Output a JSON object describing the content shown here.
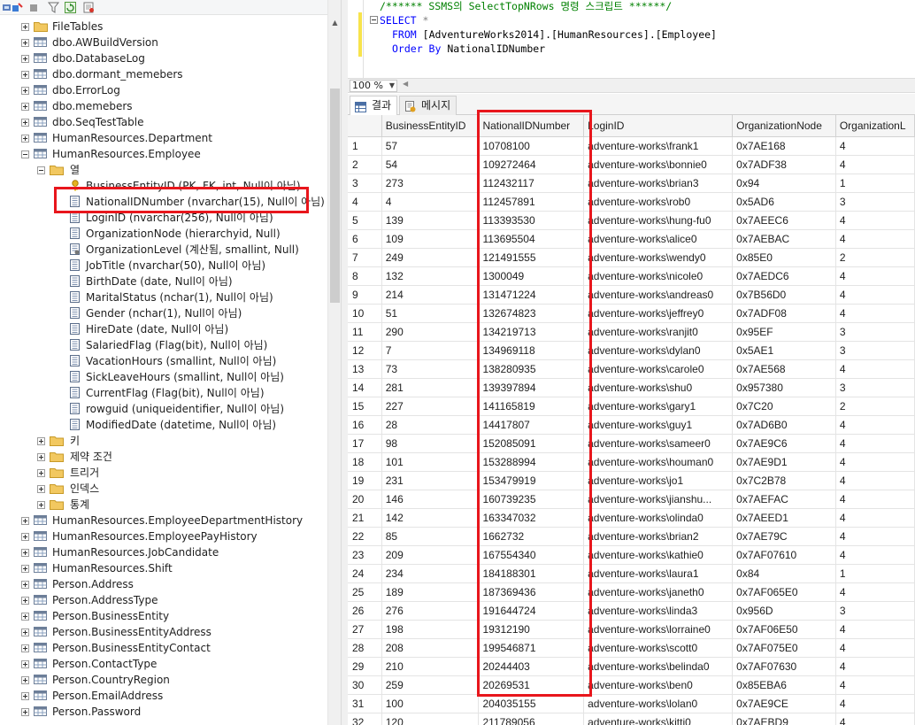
{
  "object_explorer": {
    "toolbar_icons": [
      "connect-icon",
      "connect-object-icon",
      "disconnect-icon",
      "stop-icon",
      "filter-icon",
      "refresh-icon",
      "activity-monitor-icon"
    ],
    "tree": [
      {
        "label": "FileTables",
        "level": 1,
        "icon": "folder",
        "expander": "plus"
      },
      {
        "label": "dbo.AWBuildVersion",
        "level": 1,
        "icon": "table",
        "expander": "plus"
      },
      {
        "label": "dbo.DatabaseLog",
        "level": 1,
        "icon": "table",
        "expander": "plus"
      },
      {
        "label": "dbo.dormant_memebers",
        "level": 1,
        "icon": "table",
        "expander": "plus"
      },
      {
        "label": "dbo.ErrorLog",
        "level": 1,
        "icon": "table",
        "expander": "plus"
      },
      {
        "label": "dbo.memebers",
        "level": 1,
        "icon": "table",
        "expander": "plus"
      },
      {
        "label": "dbo.SeqTestTable",
        "level": 1,
        "icon": "table",
        "expander": "plus"
      },
      {
        "label": "HumanResources.Department",
        "level": 1,
        "icon": "table",
        "expander": "plus"
      },
      {
        "label": "HumanResources.Employee",
        "level": 1,
        "icon": "table",
        "expander": "minus"
      },
      {
        "label": "열",
        "level": 2,
        "icon": "folder",
        "expander": "minus"
      },
      {
        "label": "BusinessEntityID (PK, FK, int, Null이 아님)",
        "level": 3,
        "icon": "key",
        "expander": "none"
      },
      {
        "label": "NationalIDNumber (nvarchar(15), Null이 아님)",
        "level": 3,
        "icon": "column",
        "expander": "none"
      },
      {
        "label": "LoginID (nvarchar(256), Null이 아님)",
        "level": 3,
        "icon": "column",
        "expander": "none"
      },
      {
        "label": "OrganizationNode (hierarchyid, Null)",
        "level": 3,
        "icon": "column",
        "expander": "none"
      },
      {
        "label": "OrganizationLevel (계산됨, smallint, Null)",
        "level": 3,
        "icon": "computed",
        "expander": "none"
      },
      {
        "label": "JobTitle (nvarchar(50), Null이 아님)",
        "level": 3,
        "icon": "column",
        "expander": "none"
      },
      {
        "label": "BirthDate (date, Null이 아님)",
        "level": 3,
        "icon": "column",
        "expander": "none"
      },
      {
        "label": "MaritalStatus (nchar(1), Null이 아님)",
        "level": 3,
        "icon": "column",
        "expander": "none"
      },
      {
        "label": "Gender (nchar(1), Null이 아님)",
        "level": 3,
        "icon": "column",
        "expander": "none"
      },
      {
        "label": "HireDate (date, Null이 아님)",
        "level": 3,
        "icon": "column",
        "expander": "none"
      },
      {
        "label": "SalariedFlag (Flag(bit), Null이 아님)",
        "level": 3,
        "icon": "column",
        "expander": "none"
      },
      {
        "label": "VacationHours (smallint, Null이 아님)",
        "level": 3,
        "icon": "column",
        "expander": "none"
      },
      {
        "label": "SickLeaveHours (smallint, Null이 아님)",
        "level": 3,
        "icon": "column",
        "expander": "none"
      },
      {
        "label": "CurrentFlag (Flag(bit), Null이 아님)",
        "level": 3,
        "icon": "column",
        "expander": "none"
      },
      {
        "label": "rowguid (uniqueidentifier, Null이 아님)",
        "level": 3,
        "icon": "column",
        "expander": "none"
      },
      {
        "label": "ModifiedDate (datetime, Null이 아님)",
        "level": 3,
        "icon": "column",
        "expander": "none"
      },
      {
        "label": "키",
        "level": 2,
        "icon": "folder",
        "expander": "plus"
      },
      {
        "label": "제약 조건",
        "level": 2,
        "icon": "folder",
        "expander": "plus"
      },
      {
        "label": "트리거",
        "level": 2,
        "icon": "folder",
        "expander": "plus"
      },
      {
        "label": "인덱스",
        "level": 2,
        "icon": "folder",
        "expander": "plus"
      },
      {
        "label": "통계",
        "level": 2,
        "icon": "folder",
        "expander": "plus"
      },
      {
        "label": "HumanResources.EmployeeDepartmentHistory",
        "level": 1,
        "icon": "table",
        "expander": "plus"
      },
      {
        "label": "HumanResources.EmployeePayHistory",
        "level": 1,
        "icon": "table",
        "expander": "plus"
      },
      {
        "label": "HumanResources.JobCandidate",
        "level": 1,
        "icon": "table",
        "expander": "plus"
      },
      {
        "label": "HumanResources.Shift",
        "level": 1,
        "icon": "table",
        "expander": "plus"
      },
      {
        "label": "Person.Address",
        "level": 1,
        "icon": "table",
        "expander": "plus"
      },
      {
        "label": "Person.AddressType",
        "level": 1,
        "icon": "table",
        "expander": "plus"
      },
      {
        "label": "Person.BusinessEntity",
        "level": 1,
        "icon": "table",
        "expander": "plus"
      },
      {
        "label": "Person.BusinessEntityAddress",
        "level": 1,
        "icon": "table",
        "expander": "plus"
      },
      {
        "label": "Person.BusinessEntityContact",
        "level": 1,
        "icon": "table",
        "expander": "plus"
      },
      {
        "label": "Person.ContactType",
        "level": 1,
        "icon": "table",
        "expander": "plus"
      },
      {
        "label": "Person.CountryRegion",
        "level": 1,
        "icon": "table",
        "expander": "plus"
      },
      {
        "label": "Person.EmailAddress",
        "level": 1,
        "icon": "table",
        "expander": "plus"
      },
      {
        "label": "Person.Password",
        "level": 1,
        "icon": "table",
        "expander": "plus"
      }
    ],
    "highlighted_label": "NationalIDNumber (nvarchar(15), Null이 아님)"
  },
  "editor": {
    "comment_line": "/****** SSMS의 SelectTopNRows 명령 스크립트 ******/",
    "select_kw": "SELECT",
    "select_star": "*",
    "from_kw": "FROM",
    "from_target": "[AdventureWorks2014].[HumanResources].[Employee]",
    "order_kw": "Order By",
    "order_col": "NationalIDNumber",
    "zoom": "100 %"
  },
  "results": {
    "tabs": [
      {
        "label": "결과",
        "icon": "grid-icon",
        "active": true
      },
      {
        "label": "메시지",
        "icon": "messages-icon",
        "active": false
      }
    ],
    "columns": [
      "",
      "BusinessEntityID",
      "NationalIDNumber",
      "LoginID",
      "OrganizationNode",
      "OrganizationL"
    ],
    "highlighted_column": "NationalIDNumber",
    "rows": [
      [
        "1",
        "57",
        "10708100",
        "adventure-works\\frank1",
        "0x7AE168",
        "4"
      ],
      [
        "2",
        "54",
        "109272464",
        "adventure-works\\bonnie0",
        "0x7ADF38",
        "4"
      ],
      [
        "3",
        "273",
        "112432117",
        "adventure-works\\brian3",
        "0x94",
        "1"
      ],
      [
        "4",
        "4",
        "112457891",
        "adventure-works\\rob0",
        "0x5AD6",
        "3"
      ],
      [
        "5",
        "139",
        "113393530",
        "adventure-works\\hung-fu0",
        "0x7AEEC6",
        "4"
      ],
      [
        "6",
        "109",
        "113695504",
        "adventure-works\\alice0",
        "0x7AEBAC",
        "4"
      ],
      [
        "7",
        "249",
        "121491555",
        "adventure-works\\wendy0",
        "0x85E0",
        "2"
      ],
      [
        "8",
        "132",
        "1300049",
        "adventure-works\\nicole0",
        "0x7AEDC6",
        "4"
      ],
      [
        "9",
        "214",
        "131471224",
        "adventure-works\\andreas0",
        "0x7B56D0",
        "4"
      ],
      [
        "10",
        "51",
        "132674823",
        "adventure-works\\jeffrey0",
        "0x7ADF08",
        "4"
      ],
      [
        "11",
        "290",
        "134219713",
        "adventure-works\\ranjit0",
        "0x95EF",
        "3"
      ],
      [
        "12",
        "7",
        "134969118",
        "adventure-works\\dylan0",
        "0x5AE1",
        "3"
      ],
      [
        "13",
        "73",
        "138280935",
        "adventure-works\\carole0",
        "0x7AE568",
        "4"
      ],
      [
        "14",
        "281",
        "139397894",
        "adventure-works\\shu0",
        "0x957380",
        "3"
      ],
      [
        "15",
        "227",
        "141165819",
        "adventure-works\\gary1",
        "0x7C20",
        "2"
      ],
      [
        "16",
        "28",
        "14417807",
        "adventure-works\\guy1",
        "0x7AD6B0",
        "4"
      ],
      [
        "17",
        "98",
        "152085091",
        "adventure-works\\sameer0",
        "0x7AE9C6",
        "4"
      ],
      [
        "18",
        "101",
        "153288994",
        "adventure-works\\houman0",
        "0x7AE9D1",
        "4"
      ],
      [
        "19",
        "231",
        "153479919",
        "adventure-works\\jo1",
        "0x7C2B78",
        "4"
      ],
      [
        "20",
        "146",
        "160739235",
        "adventure-works\\jianshu...",
        "0x7AEFAC",
        "4"
      ],
      [
        "21",
        "142",
        "163347032",
        "adventure-works\\olinda0",
        "0x7AEED1",
        "4"
      ],
      [
        "22",
        "85",
        "1662732",
        "adventure-works\\brian2",
        "0x7AE79C",
        "4"
      ],
      [
        "23",
        "209",
        "167554340",
        "adventure-works\\kathie0",
        "0x7AF07610",
        "4"
      ],
      [
        "24",
        "234",
        "184188301",
        "adventure-works\\laura1",
        "0x84",
        "1"
      ],
      [
        "25",
        "189",
        "187369436",
        "adventure-works\\janeth0",
        "0x7AF065E0",
        "4"
      ],
      [
        "26",
        "276",
        "191644724",
        "adventure-works\\linda3",
        "0x956D",
        "3"
      ],
      [
        "27",
        "198",
        "19312190",
        "adventure-works\\lorraine0",
        "0x7AF06E50",
        "4"
      ],
      [
        "28",
        "208",
        "199546871",
        "adventure-works\\scott0",
        "0x7AF075E0",
        "4"
      ],
      [
        "29",
        "210",
        "20244403",
        "adventure-works\\belinda0",
        "0x7AF07630",
        "4"
      ],
      [
        "30",
        "259",
        "20269531",
        "adventure-works\\ben0",
        "0x85EBA6",
        "4"
      ],
      [
        "31",
        "100",
        "204035155",
        "adventure-works\\lolan0",
        "0x7AE9CE",
        "4"
      ],
      [
        "32",
        "120",
        "211789056",
        "adventure-works\\kitti0",
        "0x7AEBD9",
        "4"
      ]
    ]
  },
  "colors": {
    "highlight": "#e8161c",
    "keyword": "#0000ff",
    "comment": "#008000"
  }
}
